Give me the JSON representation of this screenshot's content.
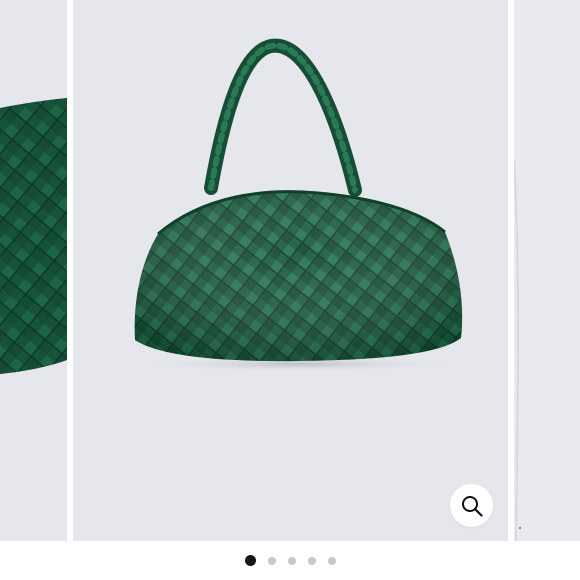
{
  "gallery": {
    "slide_count": 5,
    "active_index": 0,
    "zoom_icon": "magnifier-icon",
    "product_color": "#1d5a3f"
  },
  "pagination": {
    "dots": [
      {
        "active": true
      },
      {
        "active": false
      },
      {
        "active": false
      },
      {
        "active": false
      },
      {
        "active": false
      }
    ]
  }
}
